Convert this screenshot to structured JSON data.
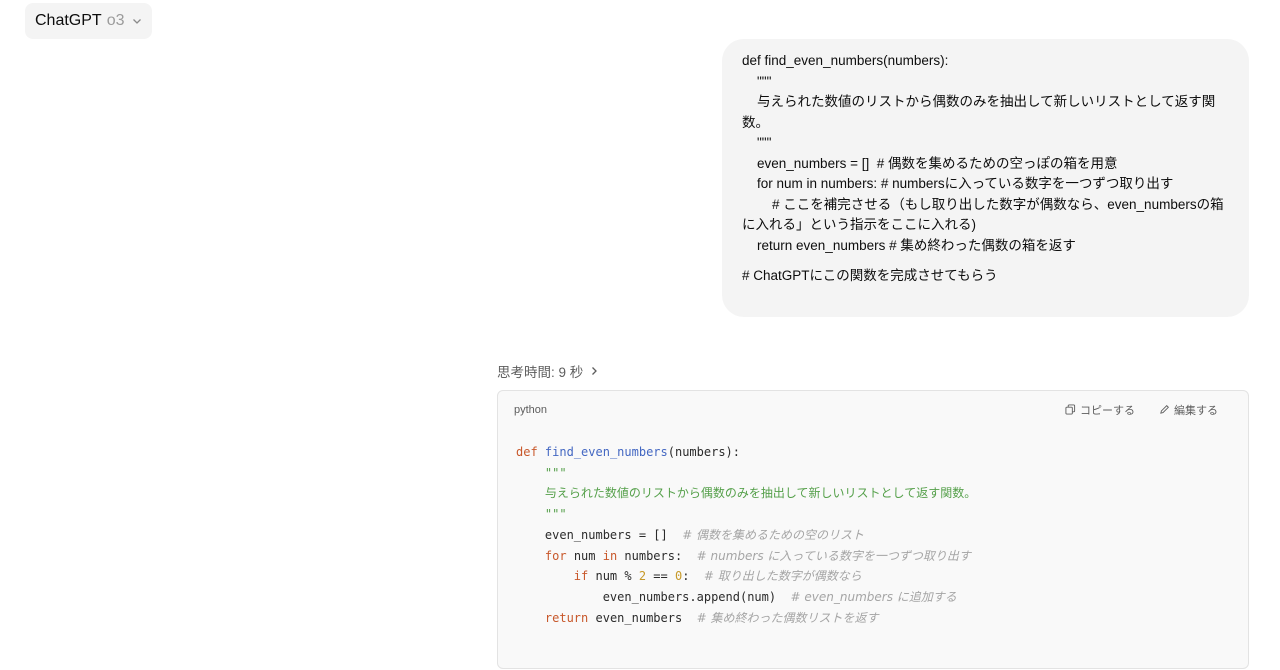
{
  "header": {
    "model_name": "ChatGPT",
    "model_version": "o3"
  },
  "user_message": {
    "lines": [
      "def find_even_numbers(numbers):",
      "    \"\"\"",
      "    与えられた数値のリストから偶数のみを抽出して新しいリストとして返す関数。",
      "    \"\"\"",
      "    even_numbers = []  # 偶数を集めるための空っぽの箱を用意",
      "    for num in numbers: # numbersに入っている数字を一つずつ取り出す",
      "        # ここを補完させる（もし取り出した数字が偶数なら、even_numbersの箱",
      "に入れる」という指示をここに入れる)",
      "    return even_numbers # 集め終わった偶数の箱を返す",
      "# ChatGPTにこの関数を完成させてもらう"
    ]
  },
  "assistant": {
    "thinking_label": "思考時間: 9 秒",
    "code_block": {
      "language": "python",
      "copy_label": "コピーする",
      "edit_label": "編集する",
      "tokens": {
        "def": "def",
        "fn_name": "find_even_numbers",
        "sig_rest": "(numbers):",
        "doc_quote": "\"\"\"",
        "doc_text": "与えられた数値のリストから偶数のみを抽出して新しいリストとして返す関数。",
        "l5_code": "even_numbers = []  ",
        "l5_cmt": "# 偶数を集めるための空のリスト",
        "l6_for": "for",
        "l6_mid1": " num ",
        "l6_in": "in",
        "l6_mid2": " numbers:  ",
        "l6_cmt": "# numbers に入っている数字を一つずつ取り出す",
        "l7_if": "if",
        "l7_mid": " num % ",
        "l7_two": "2",
        "l7_eq": " == ",
        "l7_zero": "0",
        "l7_colon": ":  ",
        "l7_cmt": "# 取り出した数字が偶数なら",
        "l8_code": "even_numbers.append(num)  ",
        "l8_cmt": "# even_numbers に追加する",
        "l9_return": "return",
        "l9_mid": " even_numbers  ",
        "l9_cmt": "# 集め終わった偶数リストを返す"
      }
    }
  },
  "colors": {
    "keyword": "#c8582b",
    "function": "#4367c2",
    "string": "#55a04a",
    "comment": "#a5a5a5",
    "number": "#c79a2a"
  }
}
